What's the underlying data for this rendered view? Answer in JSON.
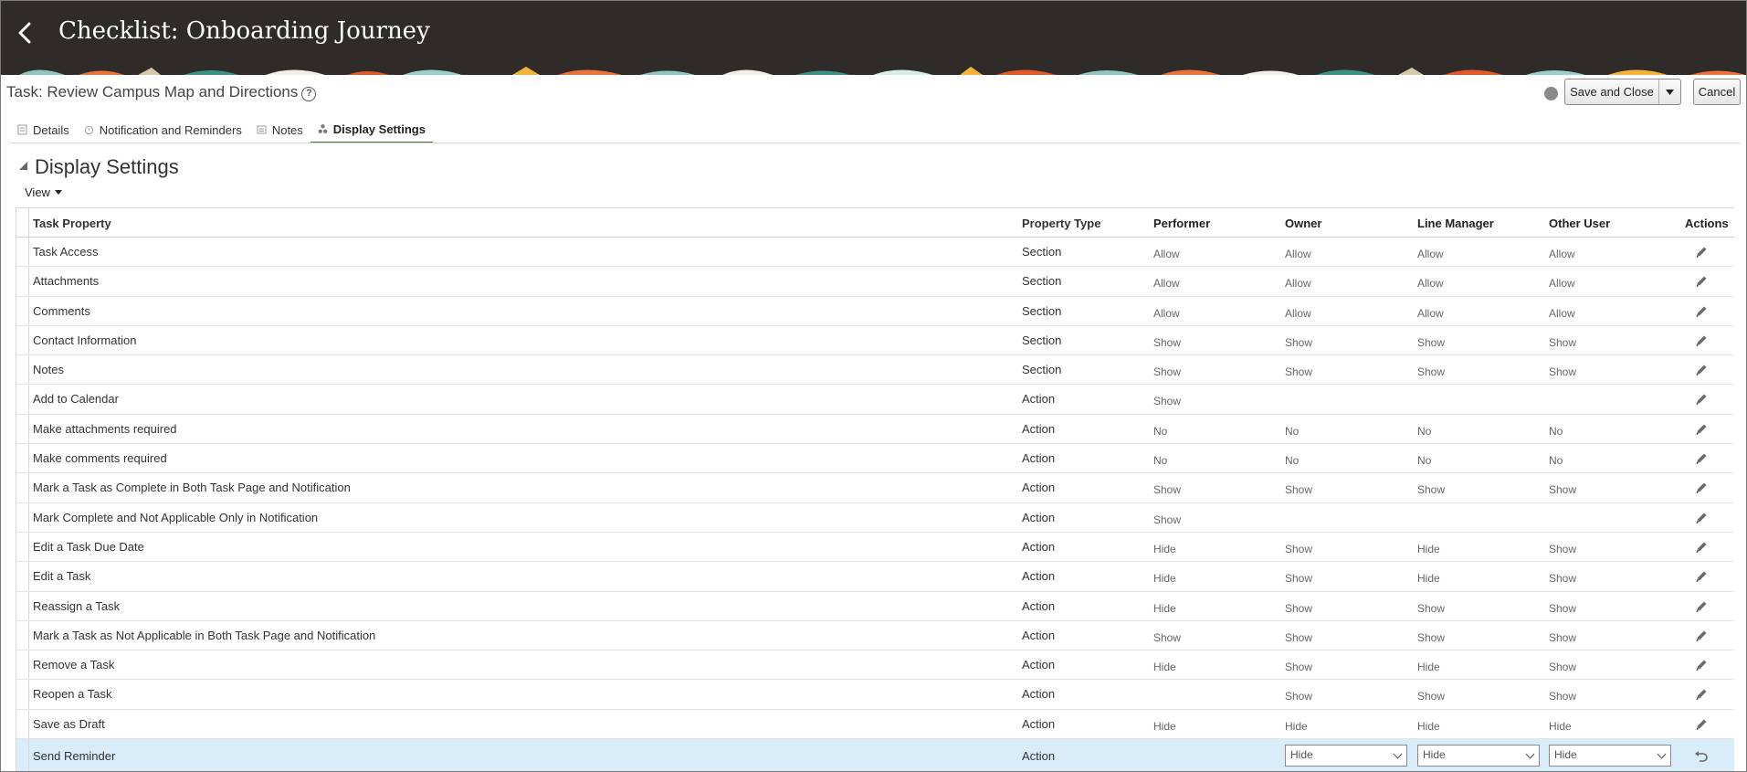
{
  "header": {
    "title": "Checklist: Onboarding Journey"
  },
  "task": {
    "title": "Task: Review Campus Map and Directions",
    "help_glyph": "?"
  },
  "toolbar": {
    "save_label": "Save and Close",
    "cancel_label": "Cancel"
  },
  "tabs": [
    {
      "label": "Details",
      "icon": "document-icon"
    },
    {
      "label": "Notification and Reminders",
      "icon": "clock-icon"
    },
    {
      "label": "Notes",
      "icon": "note-icon"
    },
    {
      "label": "Display Settings",
      "icon": "settings-icon",
      "active": true
    }
  ],
  "section": {
    "title": "Display Settings",
    "view_label": "View"
  },
  "table": {
    "headers": [
      "Task Property",
      "Property Type",
      "Performer",
      "Owner",
      "Line Manager",
      "Other User",
      "Actions"
    ],
    "rows": [
      [
        "Task Access",
        "Section",
        "Allow",
        "Allow",
        "Allow",
        "Allow"
      ],
      [
        "Attachments",
        "Section",
        "Allow",
        "Allow",
        "Allow",
        "Allow"
      ],
      [
        "Comments",
        "Section",
        "Allow",
        "Allow",
        "Allow",
        "Allow"
      ],
      [
        "Contact Information",
        "Section",
        "Show",
        "Show",
        "Show",
        "Show"
      ],
      [
        "Notes",
        "Section",
        "Show",
        "Show",
        "Show",
        "Show"
      ],
      [
        "Add to Calendar",
        "Action",
        "Show",
        "",
        "",
        ""
      ],
      [
        "Make attachments required",
        "Action",
        "No",
        "No",
        "No",
        "No"
      ],
      [
        "Make comments required",
        "Action",
        "No",
        "No",
        "No",
        "No"
      ],
      [
        "Mark a Task as Complete in Both Task Page and Notification",
        "Action",
        "Show",
        "Show",
        "Show",
        "Show"
      ],
      [
        "Mark Complete and Not Applicable Only in Notification",
        "Action",
        "Show",
        "",
        "",
        ""
      ],
      [
        "Edit a Task Due Date",
        "Action",
        "Hide",
        "Show",
        "Hide",
        "Show"
      ],
      [
        "Edit a Task",
        "Action",
        "Hide",
        "Show",
        "Hide",
        "Show"
      ],
      [
        "Reassign a Task",
        "Action",
        "Hide",
        "Show",
        "Show",
        "Show"
      ],
      [
        "Mark a Task as Not Applicable in Both Task Page and Notification",
        "Action",
        "Show",
        "Show",
        "Show",
        "Show"
      ],
      [
        "Remove a Task",
        "Action",
        "Hide",
        "Show",
        "Hide",
        "Show"
      ],
      [
        "Reopen a Task",
        "Action",
        "",
        "Show",
        "Show",
        "Show"
      ],
      [
        "Save as Draft",
        "Action",
        "Hide",
        "Hide",
        "Hide",
        "Hide"
      ]
    ],
    "selected_row": {
      "property": "Send Reminder",
      "type": "Action",
      "owner": "Hide",
      "line_manager": "Hide",
      "other_user": "Hide"
    }
  },
  "colors": {
    "topbar": "#2f2b28",
    "active_tab_underline": "#4d7a3c",
    "selected_row": "#d9ecfa"
  }
}
